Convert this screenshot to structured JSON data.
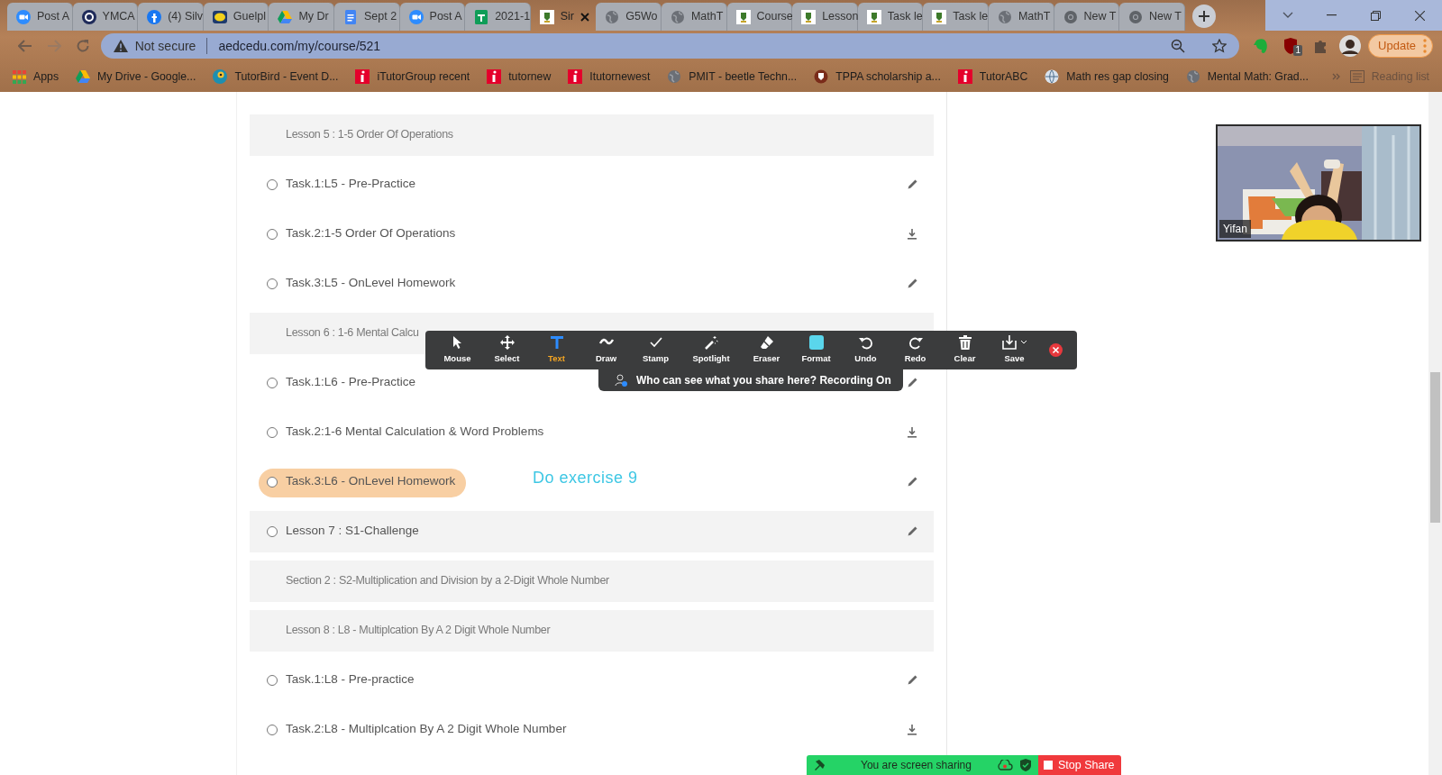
{
  "browser": {
    "tabs": [
      {
        "title": "Post A",
        "selected": false
      },
      {
        "title": "YMCA",
        "selected": false
      },
      {
        "title": "(4) Silv",
        "selected": false
      },
      {
        "title": "Guelpl",
        "selected": false
      },
      {
        "title": "My Dr",
        "selected": false
      },
      {
        "title": "Sept 2",
        "selected": false
      },
      {
        "title": "Post A",
        "selected": false
      },
      {
        "title": "2021-1",
        "selected": false
      },
      {
        "title": "Sir",
        "selected": true
      },
      {
        "title": "G5Wo",
        "selected": false
      },
      {
        "title": "MathT",
        "selected": false
      },
      {
        "title": "Course",
        "selected": false
      },
      {
        "title": "Lesson",
        "selected": false
      },
      {
        "title": "Task le",
        "selected": false
      },
      {
        "title": "Task le",
        "selected": false
      },
      {
        "title": "MathT",
        "selected": false
      },
      {
        "title": "New T",
        "selected": false
      },
      {
        "title": "New T",
        "selected": false
      }
    ],
    "address_bar": {
      "security": "Not secure",
      "url": "aedcedu.com/my/course/521"
    },
    "extension_badge": "1",
    "update_button": "Update",
    "bookmarks": [
      {
        "title": "Apps"
      },
      {
        "title": "My Drive - Google..."
      },
      {
        "title": "TutorBird - Event D..."
      },
      {
        "title": "iTutorGroup recent"
      },
      {
        "title": "tutornew"
      },
      {
        "title": "Itutornewest"
      },
      {
        "title": "PMIT - beetle Techn..."
      },
      {
        "title": "TPPA scholarship a..."
      },
      {
        "title": "TutorABC"
      },
      {
        "title": "Math res gap closing"
      },
      {
        "title": "Mental Math: Grad..."
      }
    ],
    "reading_list": "Reading list"
  },
  "course": {
    "rows": [
      {
        "kind": "header",
        "text": "Lesson 5 : 1-5 Order Of Operations"
      },
      {
        "kind": "edit",
        "text": "Task.1:L5 - Pre-Practice",
        "checked": false,
        "shaded": false,
        "highlighted": false
      },
      {
        "kind": "download",
        "text": "Task.2:1-5 Order Of Operations",
        "checked": false,
        "shaded": false,
        "highlighted": false
      },
      {
        "kind": "edit",
        "text": "Task.3:L5 - OnLevel Homework",
        "checked": false,
        "shaded": false,
        "highlighted": false
      },
      {
        "kind": "header",
        "text": "Lesson 6 : 1-6 Mental Calcu"
      },
      {
        "kind": "edit",
        "text": "Task.1:L6 - Pre-Practice",
        "checked": false,
        "shaded": false,
        "highlighted": false
      },
      {
        "kind": "download",
        "text": "Task.2:1-6 Mental Calculation & Word Problems",
        "checked": false,
        "shaded": false,
        "highlighted": false
      },
      {
        "kind": "edit",
        "text": "Task.3:L6 - OnLevel Homework",
        "checked": false,
        "shaded": false,
        "highlighted": true
      },
      {
        "kind": "edit",
        "text": "Lesson 7 : S1-Challenge",
        "checked": false,
        "shaded": true,
        "highlighted": false
      },
      {
        "kind": "header",
        "text": "Section 2 : S2-Multiplication and Division by a 2-Digit Whole Number"
      },
      {
        "kind": "header",
        "text": "Lesson 8 : L8 - Multiplcation By A 2 Digit Whole Number"
      },
      {
        "kind": "edit",
        "text": "Task.1:L8 - Pre-practice",
        "checked": false,
        "shaded": false,
        "highlighted": false
      },
      {
        "kind": "download",
        "text": "Task.2:L8 - Multiplcation By A 2 Digit Whole Number",
        "checked": false,
        "shaded": false,
        "highlighted": false
      }
    ]
  },
  "annotation_toolbar": {
    "tools": [
      {
        "label": "Mouse",
        "selected": false
      },
      {
        "label": "Select",
        "selected": false
      },
      {
        "label": "Text",
        "selected": true
      },
      {
        "label": "Draw",
        "selected": false
      },
      {
        "label": "Stamp",
        "selected": false
      },
      {
        "label": "Spotlight",
        "selected": false
      },
      {
        "label": "Eraser",
        "selected": false
      },
      {
        "label": "Format",
        "selected": false
      },
      {
        "label": "Undo",
        "selected": false
      },
      {
        "label": "Redo",
        "selected": false
      },
      {
        "label": "Clear",
        "selected": false
      },
      {
        "label": "Save",
        "selected": false
      }
    ],
    "notice": "Who can see what you share here? Recording On"
  },
  "annotations": [
    {
      "text": "Do exercise 9"
    }
  ],
  "video": {
    "name": "Yifan"
  },
  "share_bar": {
    "status": "You are screen sharing",
    "stop_button": "Stop Share"
  }
}
